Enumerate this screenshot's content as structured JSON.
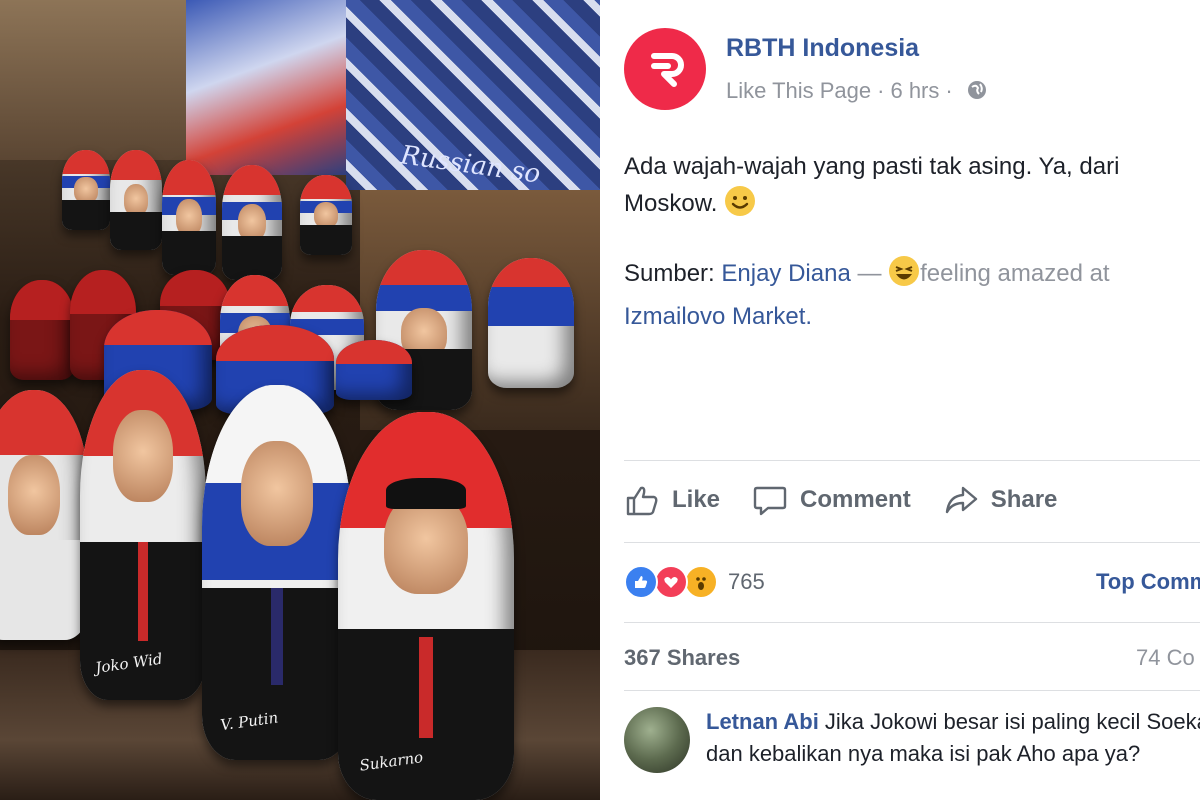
{
  "post": {
    "page_name": "RBTH Indonesia",
    "like_page": "Like This Page",
    "time": "6 hrs",
    "text_line1": "Ada wajah-wajah yang pasti tak asing. Ya, dari",
    "text_line2": "Moskow.",
    "source_label": "Sumber:",
    "source_author": "Enjay Diana",
    "source_dash": "—",
    "feeling": "feeling amazed at",
    "location": "Izmailovo Market."
  },
  "actions": {
    "like": "Like",
    "comment": "Comment",
    "share": "Share"
  },
  "stats": {
    "reactions_count": "765",
    "top_comments": "Top Comm",
    "shares": "367 Shares",
    "comments": "74 Co"
  },
  "comment": {
    "author": "Letnan Abi",
    "text": "Jika Jokowi besar isi paling kecil Soekarno dan kebalikan nya maka isi pak Aho apa ya?"
  },
  "photo": {
    "scarf_text": "Russian so",
    "doll_signatures": [
      "Joko Wid",
      "V. Putin",
      "Sukarno"
    ]
  },
  "colors": {
    "brand": "#ef2a49",
    "link": "#365899",
    "like": "#3b80f0",
    "love": "#f33e58",
    "wow": "#f7b125"
  }
}
